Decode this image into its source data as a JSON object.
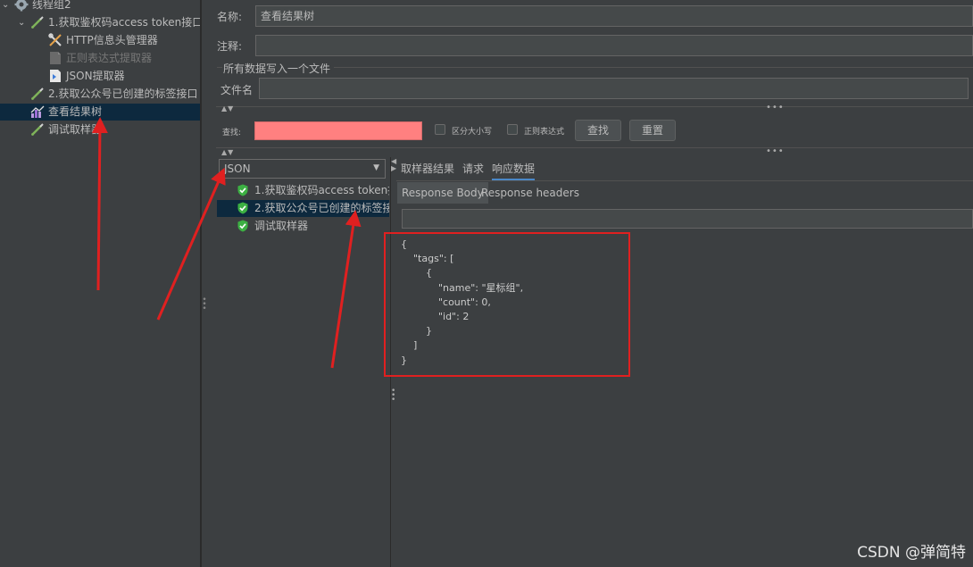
{
  "tree": {
    "items": [
      {
        "label": "线程组2",
        "icon": "gear-icon",
        "indent": 0,
        "expanded": true,
        "selected": false,
        "disabled": false
      },
      {
        "label": "1.获取鉴权码access token接口",
        "icon": "pipette-icon",
        "indent": 1,
        "expanded": true,
        "selected": false,
        "disabled": false
      },
      {
        "label": "HTTP信息头管理器",
        "icon": "wrench-icon",
        "indent": 2,
        "selected": false,
        "disabled": false
      },
      {
        "label": "正则表达式提取器",
        "icon": "extractor-icon",
        "indent": 2,
        "selected": false,
        "disabled": true
      },
      {
        "label": "JSON提取器",
        "icon": "json-extractor-icon",
        "indent": 2,
        "selected": false,
        "disabled": false
      },
      {
        "label": "2.获取公众号已创建的标签接口",
        "icon": "pipette-icon",
        "indent": 1,
        "expanded": false,
        "selected": false,
        "disabled": false
      },
      {
        "label": "查看结果树",
        "icon": "chart-icon",
        "indent": 1,
        "selected": true,
        "disabled": false
      },
      {
        "label": "调试取样器",
        "icon": "pipette-icon",
        "indent": 1,
        "selected": false,
        "disabled": false
      }
    ]
  },
  "form": {
    "name_label": "名称:",
    "name_value": "查看结果树",
    "comment_label": "注释:",
    "comment_value": "",
    "section_title": "所有数据写入一个文件",
    "filename_label": "文件名",
    "filename_value": ""
  },
  "search": {
    "label": "查找:",
    "case_label": "区分大小写",
    "regex_label": "正则表达式",
    "find_button": "查找",
    "reset_button": "重置"
  },
  "renderer": {
    "selected": "JSON"
  },
  "results": [
    {
      "label": "1.获取鉴权码access token接",
      "status": "success",
      "selected": false
    },
    {
      "label": "2.获取公众号已创建的标签接",
      "status": "success",
      "selected": true
    },
    {
      "label": "调试取样器",
      "status": "success",
      "selected": false
    }
  ],
  "tabs": [
    {
      "label": "取样器结果",
      "active": false
    },
    {
      "label": "请求",
      "active": false
    },
    {
      "label": "响应数据",
      "active": true
    }
  ],
  "subtabs": [
    {
      "label": "Response Body",
      "active": true
    },
    {
      "label": "Response headers",
      "active": false
    }
  ],
  "response_body": "{\n    \"tags\": [\n        {\n            \"name\": \"星标组\",\n            \"count\": 0,\n            \"id\": 2\n        }\n    ]\n}",
  "watermark": "CSDN @弹简特",
  "colors": {
    "background": "#3c3f41",
    "selection": "#0d293e",
    "search_highlight": "#ff8080",
    "annotation": "#e02020",
    "success": "#3cb043",
    "active_tab": "#4a88c7"
  }
}
